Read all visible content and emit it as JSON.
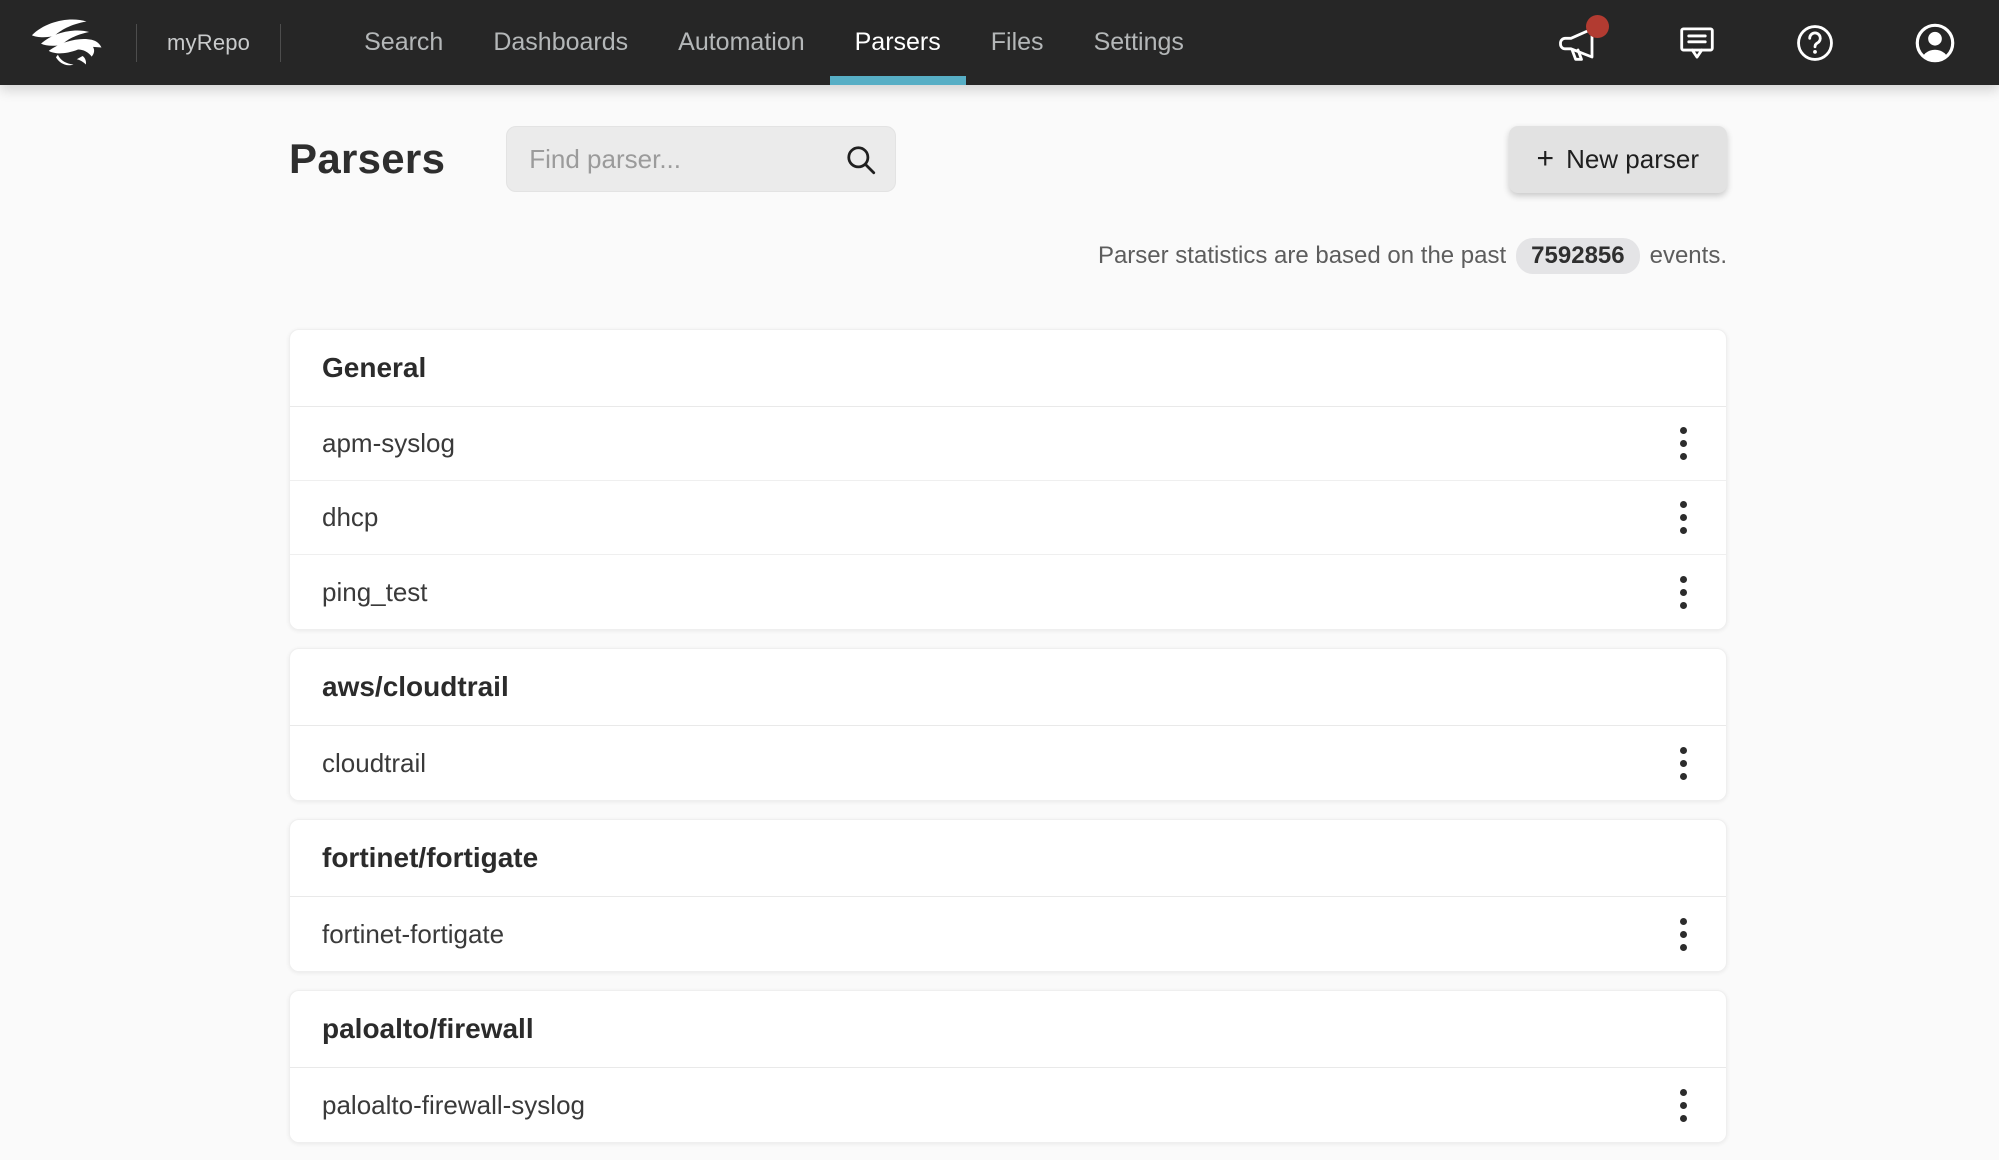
{
  "colors": {
    "accent": "#57aec5",
    "nav-bg": "#262626",
    "badge-red": "#b23b31",
    "page-bg": "#fafafa"
  },
  "nav": {
    "logo": "crowdstrike-falcon-logo",
    "repo_name": "myRepo",
    "items": [
      {
        "label": "Search",
        "active": false
      },
      {
        "label": "Dashboards",
        "active": false
      },
      {
        "label": "Automation",
        "active": false
      },
      {
        "label": "Parsers",
        "active": true
      },
      {
        "label": "Files",
        "active": false
      },
      {
        "label": "Settings",
        "active": false
      }
    ],
    "right_icons": [
      "announcements",
      "feedback",
      "help",
      "account"
    ],
    "announcements_unread": true
  },
  "header": {
    "title": "Parsers",
    "search_placeholder": "Find parser...",
    "search_value": "",
    "new_parser_plus": "+",
    "new_parser_label": "New parser"
  },
  "stats": {
    "prefix": "Parser statistics are based on the past",
    "count": "7592856",
    "suffix": "events."
  },
  "sections": [
    {
      "title": "General",
      "parsers": [
        {
          "name": "apm-syslog"
        },
        {
          "name": "dhcp"
        },
        {
          "name": "ping_test"
        }
      ]
    },
    {
      "title": "aws/cloudtrail",
      "parsers": [
        {
          "name": "cloudtrail"
        }
      ]
    },
    {
      "title": "fortinet/fortigate",
      "parsers": [
        {
          "name": "fortinet-fortigate"
        }
      ]
    },
    {
      "title": "paloalto/firewall",
      "parsers": [
        {
          "name": "paloalto-firewall-syslog"
        }
      ]
    }
  ]
}
